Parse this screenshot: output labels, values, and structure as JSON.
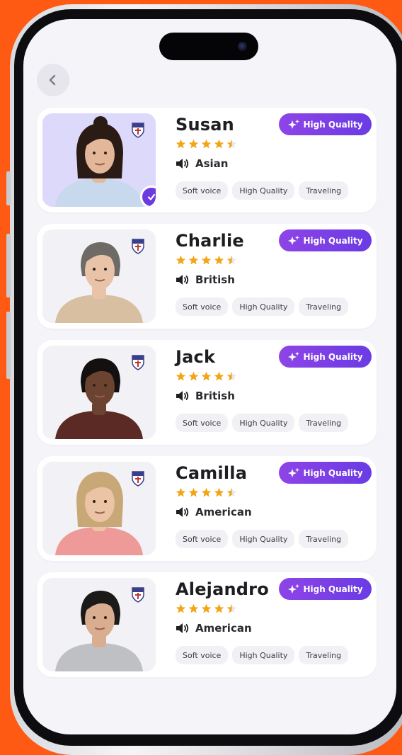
{
  "colors": {
    "background": "#FF5A14",
    "screen": "#F4F4F9",
    "accent_purple": "#7340E3",
    "star": "#F2A516",
    "selected_photo_bg": "#DCD9FB"
  },
  "header": {
    "back_icon": "chevron-left-icon"
  },
  "voices": [
    {
      "name": "Susan",
      "rating": 4.5,
      "accent": "Asian",
      "quality_label": "High Quality",
      "tags": [
        "Soft voice",
        "High Quality",
        "Traveling"
      ],
      "selected": true,
      "badge_icon": "shield-crest-icon",
      "skin": "#E2B79A",
      "hair": "#2A1B14",
      "shirt": "#C8D9EE"
    },
    {
      "name": "Charlie",
      "rating": 4.5,
      "accent": "British",
      "quality_label": "High Quality",
      "tags": [
        "Soft voice",
        "High Quality",
        "Traveling"
      ],
      "selected": false,
      "badge_icon": "shield-crest-icon",
      "skin": "#E8C3A8",
      "hair": "#6E6A66",
      "shirt": "#D8BFA1"
    },
    {
      "name": "Jack",
      "rating": 4.5,
      "accent": "British",
      "quality_label": "High Quality",
      "tags": [
        "Soft voice",
        "High Quality",
        "Traveling"
      ],
      "selected": false,
      "badge_icon": "royal-crest-icon",
      "skin": "#6B4330",
      "hair": "#141010",
      "shirt": "#5B2A24"
    },
    {
      "name": "Camilla",
      "rating": 4.5,
      "accent": "American",
      "quality_label": "High Quality",
      "tags": [
        "Soft voice",
        "High Quality",
        "Traveling"
      ],
      "selected": false,
      "badge_icon": "seal-icon",
      "skin": "#EBC4A6",
      "hair": "#C9A878",
      "shirt": "#EE9A98"
    },
    {
      "name": "Alejandro",
      "rating": 4.5,
      "accent": "American",
      "quality_label": "High Quality",
      "tags": [
        "Soft voice",
        "High Quality",
        "Traveling"
      ],
      "selected": false,
      "badge_icon": "shield-crest-icon",
      "skin": "#D9AE90",
      "hair": "#1C1A19",
      "shirt": "#BFC0C4"
    }
  ]
}
